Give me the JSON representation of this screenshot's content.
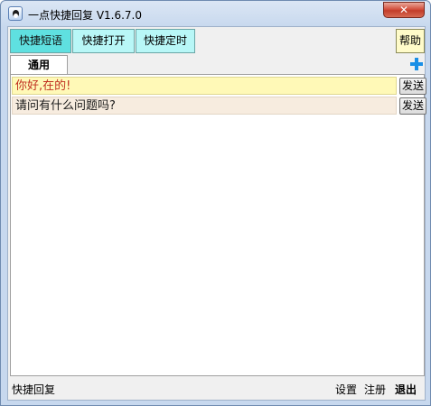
{
  "window": {
    "title": "一点快捷回复 V1.6.7.0",
    "close_label": "✕"
  },
  "top_tabs": [
    {
      "label": "快捷短语",
      "active": true
    },
    {
      "label": "快捷打开",
      "active": false
    },
    {
      "label": "快捷定时",
      "active": false
    }
  ],
  "help_label": "帮助",
  "category_tab": "通用",
  "phrases": [
    {
      "text": "你好,在的!",
      "send_label": "发送"
    },
    {
      "text": "请问有什么问题吗?",
      "send_label": "发送"
    }
  ],
  "status": {
    "left_text": "快捷回复",
    "settings_label": "设置",
    "register_label": "注册",
    "exit_label": "退出"
  },
  "colors": {
    "active_tab": "#5fe0e0",
    "inactive_tab": "#b8f7f7",
    "help_bg": "#fffbc9",
    "first_row_bg": "#fff9b7",
    "first_row_text": "#c03020",
    "second_row_bg": "#f7ecdf",
    "plus_icon": "#1a8fe6"
  }
}
